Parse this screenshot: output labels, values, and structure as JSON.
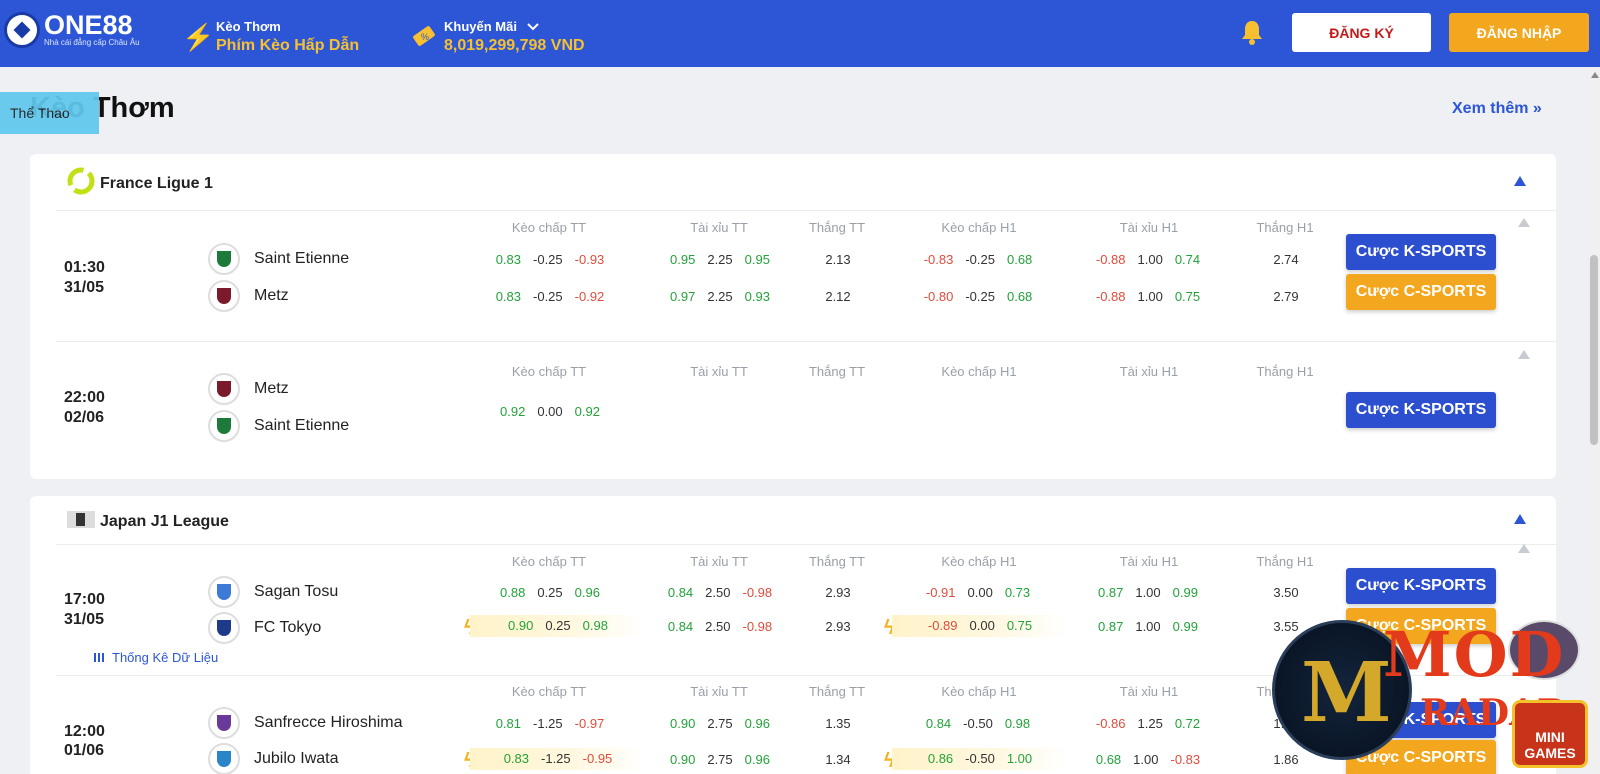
{
  "header": {
    "logo_name": "ONE88",
    "logo_tagline": "Nhà cái đẳng cấp Châu Âu",
    "keo_thom_title": "Kèo Thơm",
    "keo_thom_subtitle": "Phím Kèo Hấp Dẫn",
    "promo_title": "Khuyến Mãi",
    "promo_amount": "8,019,299,798 VND",
    "register_label": "ĐĂNG KÝ",
    "login_label": "ĐĂNG NHẬP"
  },
  "page": {
    "section_title": "Kèo Thơm",
    "sport_tag": "Thể Thao",
    "more_label": "Xem thêm"
  },
  "column_headers": [
    "Kèo chấp TT",
    "Tài xỉu TT",
    "Thắng TT",
    "Kèo chấp H1",
    "Tài xỉu H1",
    "Thắng H1"
  ],
  "buttons": {
    "k_sports": "Cược K-SPORTS",
    "c_sports": "Cược C-SPORTS"
  },
  "stats_label": "Thống Kê Dữ Liệu",
  "leagues": [
    {
      "name": "France Ligue 1",
      "matches": [
        {
          "time": "01:30",
          "date": "31/05",
          "home": "Saint Etienne",
          "away": "Metz",
          "rows": [
            {
              "hdp_tt": [
                "0.83",
                "-0.25",
                "-0.93"
              ],
              "ou_tt": [
                "0.95",
                "2.25",
                "0.95"
              ],
              "win_tt": "2.13",
              "hdp_h1": [
                "-0.83",
                "-0.25",
                "0.68"
              ],
              "ou_h1": [
                "-0.88",
                "1.00",
                "0.74"
              ],
              "win_h1": "2.74"
            },
            {
              "hdp_tt": [
                "0.83",
                "-0.25",
                "-0.92"
              ],
              "ou_tt": [
                "0.97",
                "2.25",
                "0.93"
              ],
              "win_tt": "2.12",
              "hdp_h1": [
                "-0.80",
                "-0.25",
                "0.68"
              ],
              "ou_h1": [
                "-0.88",
                "1.00",
                "0.75"
              ],
              "win_h1": "2.79"
            }
          ]
        },
        {
          "time": "22:00",
          "date": "02/06",
          "home": "Metz",
          "away": "Saint Etienne",
          "rows": [
            {
              "hdp_tt": [
                "0.92",
                "0.00",
                "0.92"
              ]
            }
          ]
        }
      ]
    },
    {
      "name": "Japan J1 League",
      "matches": [
        {
          "time": "17:00",
          "date": "31/05",
          "home": "Sagan Tosu",
          "away": "FC Tokyo",
          "rows": [
            {
              "hdp_tt": [
                "0.88",
                "0.25",
                "0.96"
              ],
              "ou_tt": [
                "0.84",
                "2.50",
                "-0.98"
              ],
              "win_tt": "2.93",
              "hdp_h1": [
                "-0.91",
                "0.00",
                "0.73"
              ],
              "ou_h1": [
                "0.87",
                "1.00",
                "0.99"
              ],
              "win_h1": "3.50"
            },
            {
              "hdp_tt": [
                "0.90",
                "0.25",
                "0.98"
              ],
              "ou_tt": [
                "0.84",
                "2.50",
                "-0.98"
              ],
              "win_tt": "2.93",
              "hdp_h1": [
                "-0.89",
                "0.00",
                "0.75"
              ],
              "ou_h1": [
                "0.87",
                "1.00",
                "0.99"
              ],
              "win_h1": "3.55"
            }
          ]
        },
        {
          "time": "12:00",
          "date": "01/06",
          "home": "Sanfrecce Hiroshima",
          "away": "Jubilo Iwata",
          "rows": [
            {
              "hdp_tt": [
                "0.81",
                "-1.25",
                "-0.97"
              ],
              "ou_tt": [
                "0.90",
                "2.75",
                "0.96"
              ],
              "win_tt": "1.35",
              "hdp_h1": [
                "0.84",
                "-0.50",
                "0.98"
              ],
              "ou_h1": [
                "-0.86",
                "1.25",
                "0.72"
              ],
              "win_h1": "1.83"
            },
            {
              "hdp_tt": [
                "0.83",
                "-1.25",
                "-0.95"
              ],
              "ou_tt": [
                "0.90",
                "2.75",
                "0.96"
              ],
              "win_tt": "1.34",
              "hdp_h1": [
                "0.86",
                "-0.50",
                "1.00"
              ],
              "ou_h1": [
                "0.68",
                "1.00",
                "-0.83"
              ],
              "win_h1": "1.86"
            }
          ]
        }
      ]
    }
  ],
  "overlay": {
    "wm_text": "MOD",
    "wm_sub": "RADAR",
    "mini_games": "MINI GAMES"
  },
  "colors": {
    "brand_blue": "#2c56d6",
    "accent_orange": "#f3a71f",
    "odds_positive": "#23a23a",
    "odds_negative": "#e04c3c"
  }
}
